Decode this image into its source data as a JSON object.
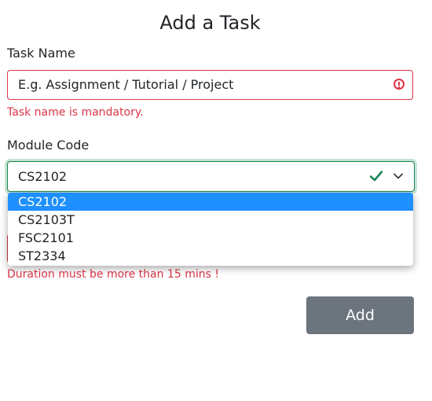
{
  "form": {
    "title": "Add a Task",
    "task_name": {
      "label": "Task Name",
      "placeholder": "E.g. Assignment / Tutorial / Project",
      "error": "Task name is mandatory."
    },
    "module_code": {
      "label": "Module Code",
      "selected": "CS2102",
      "options": [
        "CS2102",
        "CS2103T",
        "FSC2101",
        "ST2334"
      ]
    },
    "duration": {
      "error": "Duration must be more than 15 mins !"
    },
    "add_button_label": "Add"
  },
  "colors": {
    "error": "#dc3545",
    "valid": "#198754",
    "highlight": "#1e90ff",
    "button": "#6c757d"
  },
  "icons": {
    "task_error": "error-circle-icon",
    "module_valid": "check-icon",
    "module_dropdown": "chevron-down-icon"
  }
}
